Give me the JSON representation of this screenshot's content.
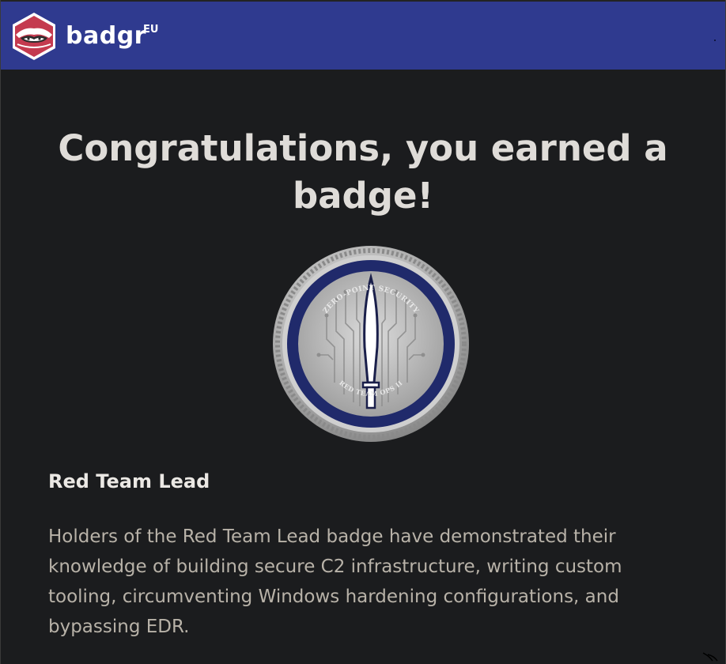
{
  "header": {
    "brand": "badgr",
    "region": "EU"
  },
  "main": {
    "heading": "Congratulations, you earned a badge!",
    "badge": {
      "image_top_text": "ZERO-POINT SECURITY",
      "image_bottom_text": "RED TEAM OPS II",
      "name": "Red Team Lead",
      "description": "Holders of the Red Team Lead badge have demonstrated their knowledge of building secure C2 infrastructure, writing custom tooling, circumventing Windows hardening configurations, and bypassing EDR."
    }
  },
  "colors": {
    "header_bg": "#2f3a8f",
    "page_bg": "#1b1c1e",
    "logo_red": "#c43a4f",
    "badge_navy": "#202a6b"
  }
}
